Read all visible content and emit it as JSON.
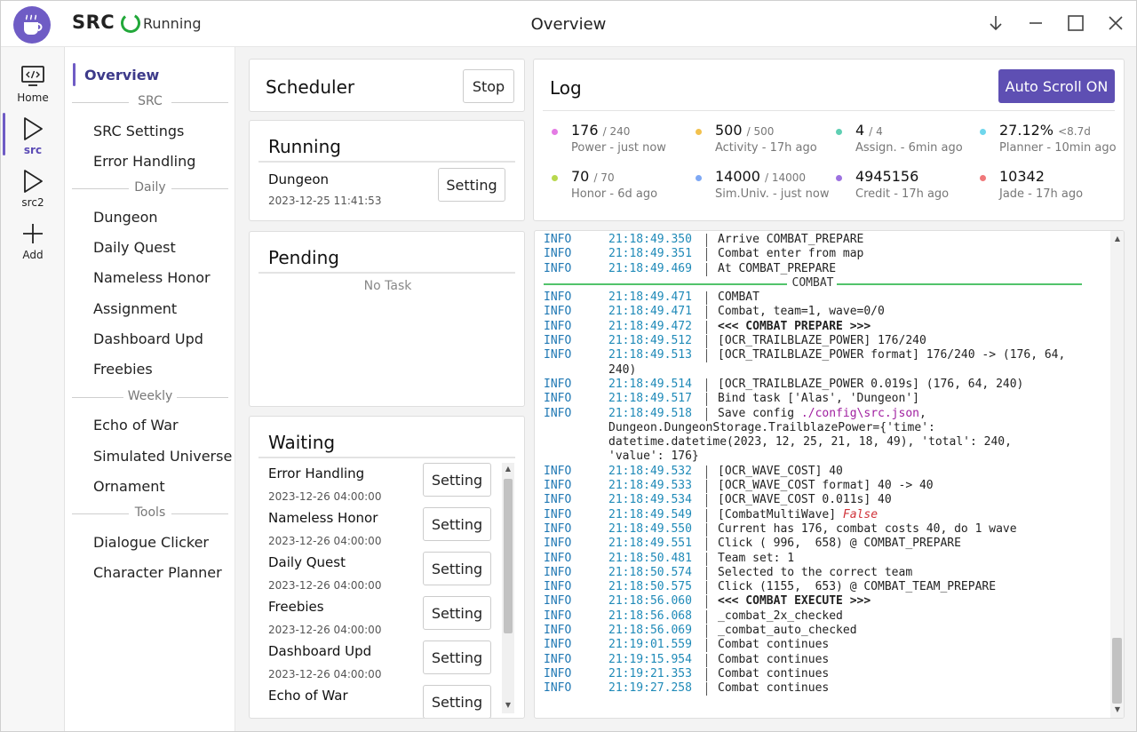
{
  "app": {
    "name": "SRC",
    "status": "Running",
    "window_title": "Overview",
    "accent": "#6f5cc5"
  },
  "rail": [
    {
      "label": "Home",
      "icon": "home-code-icon"
    },
    {
      "label": "src",
      "icon": "play-icon",
      "active": true
    },
    {
      "label": "src2",
      "icon": "play-icon"
    },
    {
      "label": "Add",
      "icon": "plus-icon"
    }
  ],
  "menu": {
    "overview": "Overview",
    "groups": {
      "src": "SRC",
      "daily": "Daily",
      "weekly": "Weekly",
      "tools": "Tools"
    },
    "items": {
      "src_settings": "SRC Settings",
      "error_handling": "Error Handling",
      "dungeon": "Dungeon",
      "daily_quest": "Daily Quest",
      "nameless_honor": "Nameless Honor",
      "assignment": "Assignment",
      "dashboard_upd": "Dashboard Upd",
      "freebies": "Freebies",
      "echo_of_war": "Echo of War",
      "simulated_universe": "Simulated Universe",
      "ornament": "Ornament",
      "dialogue_clicker": "Dialogue Clicker",
      "character_planner": "Character Planner"
    }
  },
  "scheduler": {
    "title": "Scheduler",
    "stop_label": "Stop"
  },
  "running": {
    "title": "Running",
    "task": {
      "name": "Dungeon",
      "time": "2023-12-25 11:41:53",
      "button": "Setting"
    }
  },
  "pending": {
    "title": "Pending",
    "empty": "No Task"
  },
  "waiting": {
    "title": "Waiting",
    "tasks": [
      {
        "name": "Error Handling",
        "time": "2023-12-26 04:00:00",
        "button": "Setting"
      },
      {
        "name": "Nameless Honor",
        "time": "2023-12-26 04:00:00",
        "button": "Setting"
      },
      {
        "name": "Daily Quest",
        "time": "2023-12-26 04:00:00",
        "button": "Setting"
      },
      {
        "name": "Freebies",
        "time": "2023-12-26 04:00:00",
        "button": "Setting"
      },
      {
        "name": "Dashboard Upd",
        "time": "2023-12-26 04:00:00",
        "button": "Setting"
      },
      {
        "name": "Echo of War",
        "time": "",
        "button": "Setting"
      }
    ]
  },
  "log": {
    "title": "Log",
    "auto_scroll_label": "Auto Scroll ON",
    "dashboard": [
      {
        "value": "176",
        "total": "/ 240",
        "sub": "Power - just now",
        "color": "#e47be4"
      },
      {
        "value": "500",
        "total": "/ 500",
        "sub": "Activity - 17h ago",
        "color": "#f2c14e"
      },
      {
        "value": "4",
        "total": "/ 4",
        "sub": "Assign. - 6min ago",
        "color": "#5fcfb3"
      },
      {
        "value": "27.12%",
        "total": "<8.7d",
        "sub": "Planner - 10min ago",
        "color": "#6fd6ec"
      },
      {
        "value": "70",
        "total": "/ 70",
        "sub": "Honor - 6d ago",
        "color": "#b8d84e"
      },
      {
        "value": "14000",
        "total": "/ 14000",
        "sub": "Sim.Univ. - just now",
        "color": "#7ea8f4"
      },
      {
        "value": "4945156",
        "total": "",
        "sub": "Credit - 17h ago",
        "color": "#9d72e0"
      },
      {
        "value": "10342",
        "total": "",
        "sub": "Jade - 17h ago",
        "color": "#f0787a"
      }
    ],
    "lines": [
      {
        "level": "INFO",
        "time": "21:18:49.350",
        "msg": "Arrive COMBAT_PREPARE"
      },
      {
        "level": "INFO",
        "time": "21:18:49.351",
        "msg": "Combat enter from map"
      },
      {
        "level": "INFO",
        "time": "21:18:49.469",
        "msg": "At COMBAT_PREPARE"
      },
      {
        "separator": "COMBAT"
      },
      {
        "level": "INFO",
        "time": "21:18:49.471",
        "msg": "COMBAT"
      },
      {
        "level": "INFO",
        "time": "21:18:49.471",
        "msg": "Combat, team=1, wave=0/0"
      },
      {
        "level": "INFO",
        "time": "21:18:49.472",
        "msg": "<<< COMBAT PREPARE >>>",
        "bold": true
      },
      {
        "level": "INFO",
        "time": "21:18:49.512",
        "msg": "[OCR_TRAILBLAZE_POWER] 176/240"
      },
      {
        "level": "INFO",
        "time": "21:18:49.513",
        "msg": "[OCR_TRAILBLAZE_POWER format] 176/240 -> (176, 64,"
      },
      {
        "cont": "240)"
      },
      {
        "level": "INFO",
        "time": "21:18:49.514",
        "msg": "[OCR_TRAILBLAZE_POWER 0.019s] (176, 64, 240)"
      },
      {
        "level": "INFO",
        "time": "21:18:49.517",
        "msg": "Bind task ['Alas', 'Dungeon']"
      },
      {
        "level": "INFO",
        "time": "21:18:49.518",
        "msg": "Save config ",
        "path": "./config\\src.json",
        "after": ","
      },
      {
        "cont": "Dungeon.DungeonStorage.TrailblazePower={'time':"
      },
      {
        "cont": "datetime.datetime(2023, 12, 25, 21, 18, 49), 'total': 240,"
      },
      {
        "cont": "'value': 176}"
      },
      {
        "level": "INFO",
        "time": "21:18:49.532",
        "msg": "[OCR_WAVE_COST] 40"
      },
      {
        "level": "INFO",
        "time": "21:18:49.533",
        "msg": "[OCR_WAVE_COST format] 40 -> 40"
      },
      {
        "level": "INFO",
        "time": "21:18:49.534",
        "msg": "[OCR_WAVE_COST 0.011s] 40"
      },
      {
        "level": "INFO",
        "time": "21:18:49.549",
        "msg": "[CombatMultiWave] ",
        "false": "False"
      },
      {
        "level": "INFO",
        "time": "21:18:49.550",
        "msg": "Current has 176, combat costs 40, do 1 wave"
      },
      {
        "level": "INFO",
        "time": "21:18:49.551",
        "msg": "Click ( 996,  658) @ COMBAT_PREPARE"
      },
      {
        "level": "INFO",
        "time": "21:18:50.481",
        "msg": "Team set: 1"
      },
      {
        "level": "INFO",
        "time": "21:18:50.574",
        "msg": "Selected to the correct team"
      },
      {
        "level": "INFO",
        "time": "21:18:50.575",
        "msg": "Click (1155,  653) @ COMBAT_TEAM_PREPARE"
      },
      {
        "level": "INFO",
        "time": "21:18:56.060",
        "msg": "<<< COMBAT EXECUTE >>>",
        "bold": true
      },
      {
        "level": "INFO",
        "time": "21:18:56.068",
        "msg": "_combat_2x_checked"
      },
      {
        "level": "INFO",
        "time": "21:18:56.069",
        "msg": "_combat_auto_checked"
      },
      {
        "level": "INFO",
        "time": "21:19:01.559",
        "msg": "Combat continues"
      },
      {
        "level": "INFO",
        "time": "21:19:15.954",
        "msg": "Combat continues"
      },
      {
        "level": "INFO",
        "time": "21:19:21.353",
        "msg": "Combat continues"
      },
      {
        "level": "INFO",
        "time": "21:19:27.258",
        "msg": "Combat continues"
      }
    ]
  }
}
